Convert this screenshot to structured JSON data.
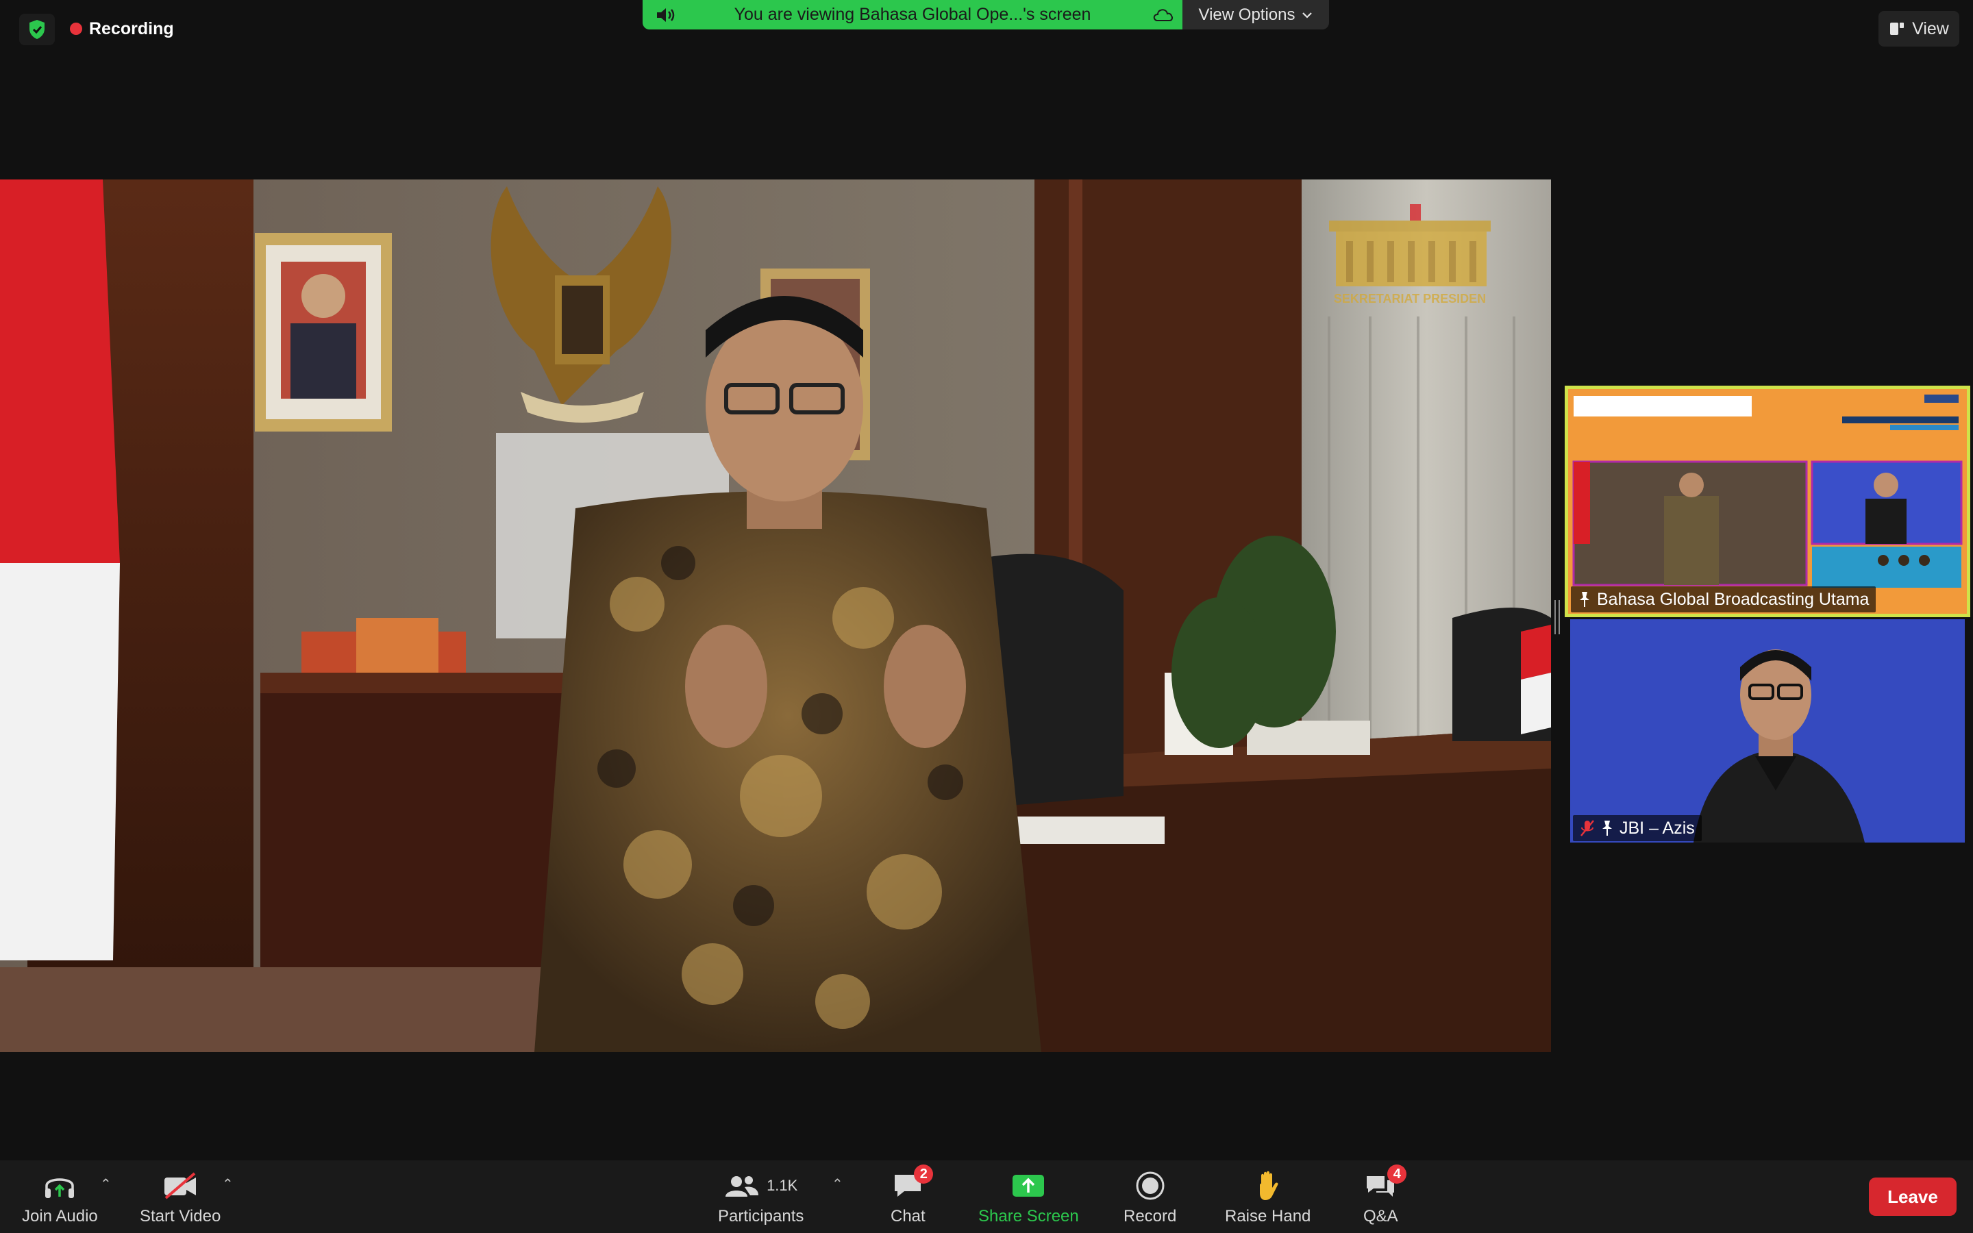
{
  "top_bar": {
    "recording_label": "Recording",
    "share_banner_text": "You are viewing Bahasa Global Ope...'s screen",
    "view_options_label": "View Options",
    "view_label": "View"
  },
  "main_video": {
    "watermark_text": "SEKRETARIAT PRESIDEN"
  },
  "thumbnails": [
    {
      "label": "Bahasa Global Broadcasting Utama",
      "pinned": true,
      "muted": false,
      "active_speaker": true
    },
    {
      "label": "JBI – Azis",
      "pinned": true,
      "muted": true,
      "active_speaker": false
    }
  ],
  "toolbar": {
    "join_audio": "Join Audio",
    "start_video": "Start Video",
    "participants": "Participants",
    "participants_count": "1.1K",
    "chat": "Chat",
    "chat_badge": "2",
    "share_screen": "Share Screen",
    "record": "Record",
    "raise_hand": "Raise Hand",
    "qa": "Q&A",
    "qa_badge": "4",
    "leave": "Leave"
  },
  "colors": {
    "share_green": "#2cc74d",
    "leave_red": "#d7272e",
    "active_speaker_border": "#cfe34a",
    "background": "#111111"
  }
}
